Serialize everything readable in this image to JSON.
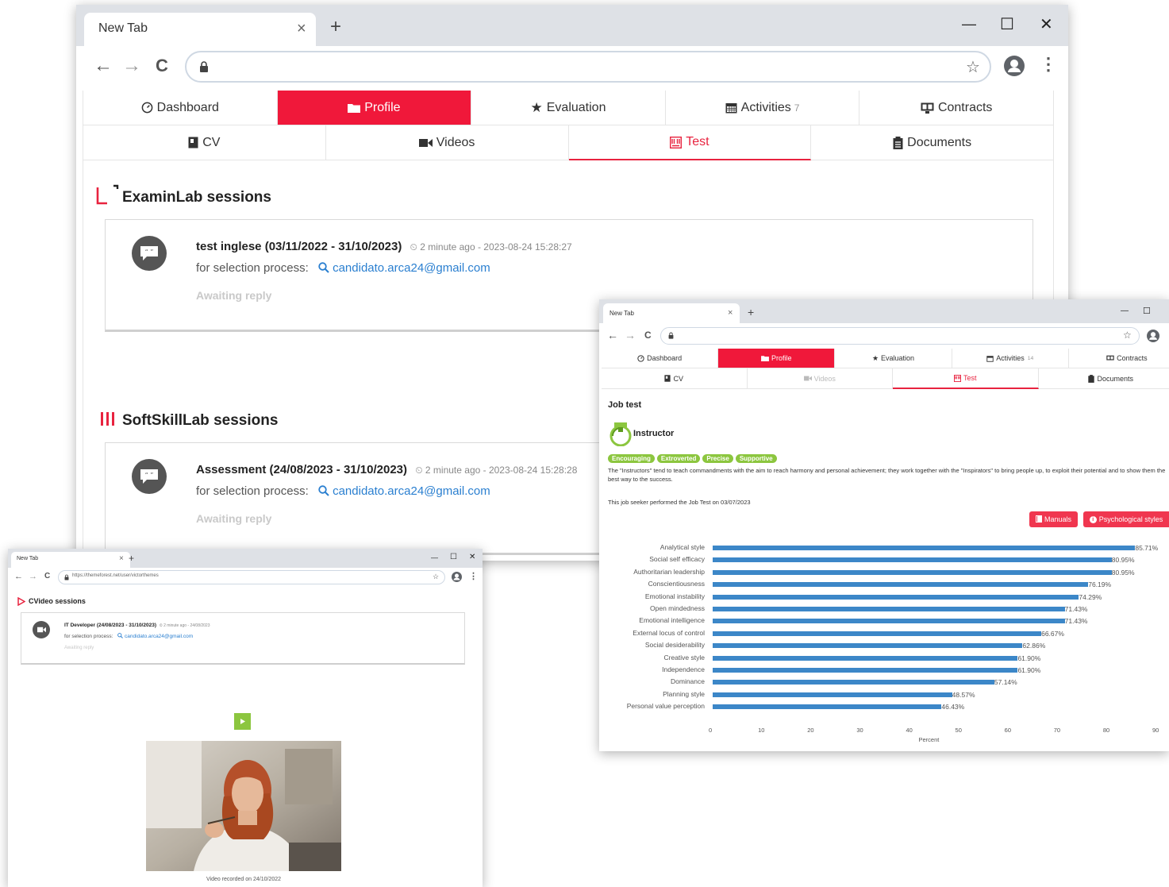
{
  "browser": {
    "tab_title": "New Tab",
    "new_tab_glyph": "+",
    "close_glyph": "×",
    "minimize_glyph": "—",
    "maximize_glyph": "☐",
    "exit_glyph": "✕",
    "back_glyph": "←",
    "forward_glyph": "→",
    "reload_glyph": "C",
    "star_glyph": "☆",
    "kebab_glyph": "⋮"
  },
  "main": {
    "menu": [
      {
        "label": "Dashboard",
        "icon": "dashboard-icon"
      },
      {
        "label": "Profile",
        "icon": "folder-icon"
      },
      {
        "label": "Evaluation",
        "icon": "star-icon"
      },
      {
        "label": "Activities",
        "icon": "calendar-icon",
        "count": "7"
      },
      {
        "label": "Contracts",
        "icon": "contract-icon"
      }
    ],
    "submenu": [
      {
        "label": "CV",
        "icon": "cv-icon"
      },
      {
        "label": "Videos",
        "icon": "video-icon"
      },
      {
        "label": "Test",
        "icon": "test-icon"
      },
      {
        "label": "Documents",
        "icon": "clipboard-icon"
      }
    ],
    "examinlab": {
      "title": "ExaminLab sessions",
      "session": {
        "title": "test inglese (03/11/2022 - 31/10/2023)",
        "time": "2 minute ago - 2023-08-24 15:28:27",
        "selection_label": "for selection process:",
        "email": "candidato.arca24@gmail.com",
        "status": "Awaiting reply"
      }
    },
    "softskill": {
      "title": "SoftSkillLab sessions",
      "session": {
        "title": "Assessment (24/08/2023 - 31/10/2023)",
        "time": "2 minute ago - 2023-08-24 15:28:28",
        "selection_label": "for selection process:",
        "email": "candidato.arca24@gmail.com",
        "status": "Awaiting reply"
      }
    }
  },
  "cvideo": {
    "tab_title": "New Tab",
    "url": "https://themeforest.net/user/victorthemes",
    "title": "CVideo sessions",
    "session": {
      "title": "IT Developer (24/08/2023 - 31/10/2023)",
      "time": "2 minute ago - 24/08/2023",
      "selection_label": "for selection process:",
      "email": "candidato.arca24@gmail.com",
      "status": "Awaiting reply"
    },
    "caption": "Video recorded on 24/10/2022"
  },
  "jobtest": {
    "tab_title": "New Tab",
    "menu": [
      {
        "label": "Dashboard"
      },
      {
        "label": "Profile"
      },
      {
        "label": "Evaluation"
      },
      {
        "label": "Activities",
        "count": "14"
      },
      {
        "label": "Contracts"
      }
    ],
    "submenu": [
      {
        "label": "CV"
      },
      {
        "label": "Videos"
      },
      {
        "label": "Test"
      },
      {
        "label": "Documents"
      }
    ],
    "heading": "Job test",
    "profile_name": "Instructor",
    "tags": [
      "Encouraging",
      "Extroverted",
      "Precise",
      "Supportive"
    ],
    "description": "The \"Instructors\" tend to teach commandments with the aim to reach harmony and personal achievement; they work together with the \"Inspirators\" to bring people up, to exploit their potential and to show them the best way to the success.",
    "performed_text": "This job seeker performed the Job Test on 03/07/2023",
    "manuals_label": "Manuals",
    "styles_label": "Psychological styles"
  },
  "colors": {
    "accent": "#f0183a",
    "link": "#2a7fd0",
    "bar": "#3c87c8",
    "tag": "#8cc63f"
  },
  "chart_data": {
    "type": "bar",
    "orientation": "horizontal",
    "categories": [
      "Analytical style",
      "Social self efficacy",
      "Authoritarian leadership",
      "Conscientiousness",
      "Emotional instability",
      "Open mindedness",
      "Emotional intelligence",
      "External locus of control",
      "Social desiderability",
      "Creative style",
      "Independence",
      "Dominance",
      "Planning style",
      "Personal value perception"
    ],
    "values": [
      85.71,
      80.95,
      80.95,
      76.19,
      74.29,
      71.43,
      71.43,
      66.67,
      62.86,
      61.9,
      61.9,
      57.14,
      48.57,
      46.43
    ],
    "value_labels": [
      "85.71%",
      "80.95%",
      "80.95%",
      "76.19%",
      "74.29%",
      "71.43%",
      "71.43%",
      "66.67%",
      "62.86%",
      "61.90%",
      "61.90%",
      "57.14%",
      "48.57%",
      "46.43%"
    ],
    "xlabel": "Percent",
    "xlim": [
      0,
      90
    ],
    "ticks": [
      "0",
      "10",
      "20",
      "30",
      "40",
      "50",
      "60",
      "70",
      "80",
      "90"
    ]
  }
}
